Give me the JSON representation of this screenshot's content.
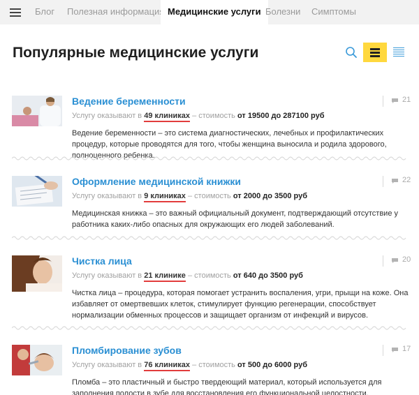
{
  "nav": {
    "tabs": [
      {
        "label": "Блог"
      },
      {
        "label": "Полезная информация"
      },
      {
        "label": "Медицинские услуги",
        "active": true
      },
      {
        "label": "Болезни"
      },
      {
        "label": "Симптомы"
      }
    ]
  },
  "page": {
    "title": "Популярные медицинские услуги"
  },
  "colors": {
    "accent_link": "#2a8fd3",
    "active_view": "#ffd83e",
    "underline": "#e23c3c"
  },
  "icons": [
    "menu-icon",
    "search-icon",
    "list-view-icon",
    "compact-view-icon",
    "comment-icon"
  ],
  "services": [
    {
      "title": "Ведение беременности",
      "prefix": "Услугу оказывают в",
      "clinics": "49 клиниках",
      "sep": "– стоимость",
      "price": "от 19500 до 287100 руб",
      "description": "Ведение беременности – это система диагностических, лечебных и профилактических процедур, которые проводятся для того, чтобы женщина выносила и родила здорового, полноценного ребенка.",
      "comments": "21"
    },
    {
      "title": "Оформление медицинской книжки",
      "prefix": "Услугу оказывают в",
      "clinics": "9 клиниках",
      "sep": "– стоимость",
      "price": "от 2000 до 3500 руб",
      "description": "Медицинская книжка – это важный официальный документ, подтверждающий отсутствие у работника каких-либо опасных для окружающих его людей заболеваний.",
      "comments": "22"
    },
    {
      "title": "Чистка лица",
      "prefix": "Услугу оказывают в",
      "clinics": "21 клинике",
      "sep": "– стоимость",
      "price": "от 640 до 3500 руб",
      "description": "Чистка лица – процедура, которая помогает устранить воспаления, угри, прыщи на коже. Она избавляет от омертвевших клеток, стимулирует функцию регенерации, способствует нормализации обменных процессов и защищает организм от инфекций и вирусов.",
      "comments": "20"
    },
    {
      "title": "Пломбирование зубов",
      "prefix": "Услугу оказывают в",
      "clinics": "76 клиниках",
      "sep": "– стоимость",
      "price": "от 500 до 6000 руб",
      "description": "Пломба – это пластичный и быстро твердеющий материал, который используется для заполнения полости в зубе для восстановления его функциональной целостности.",
      "comments": "17"
    }
  ]
}
